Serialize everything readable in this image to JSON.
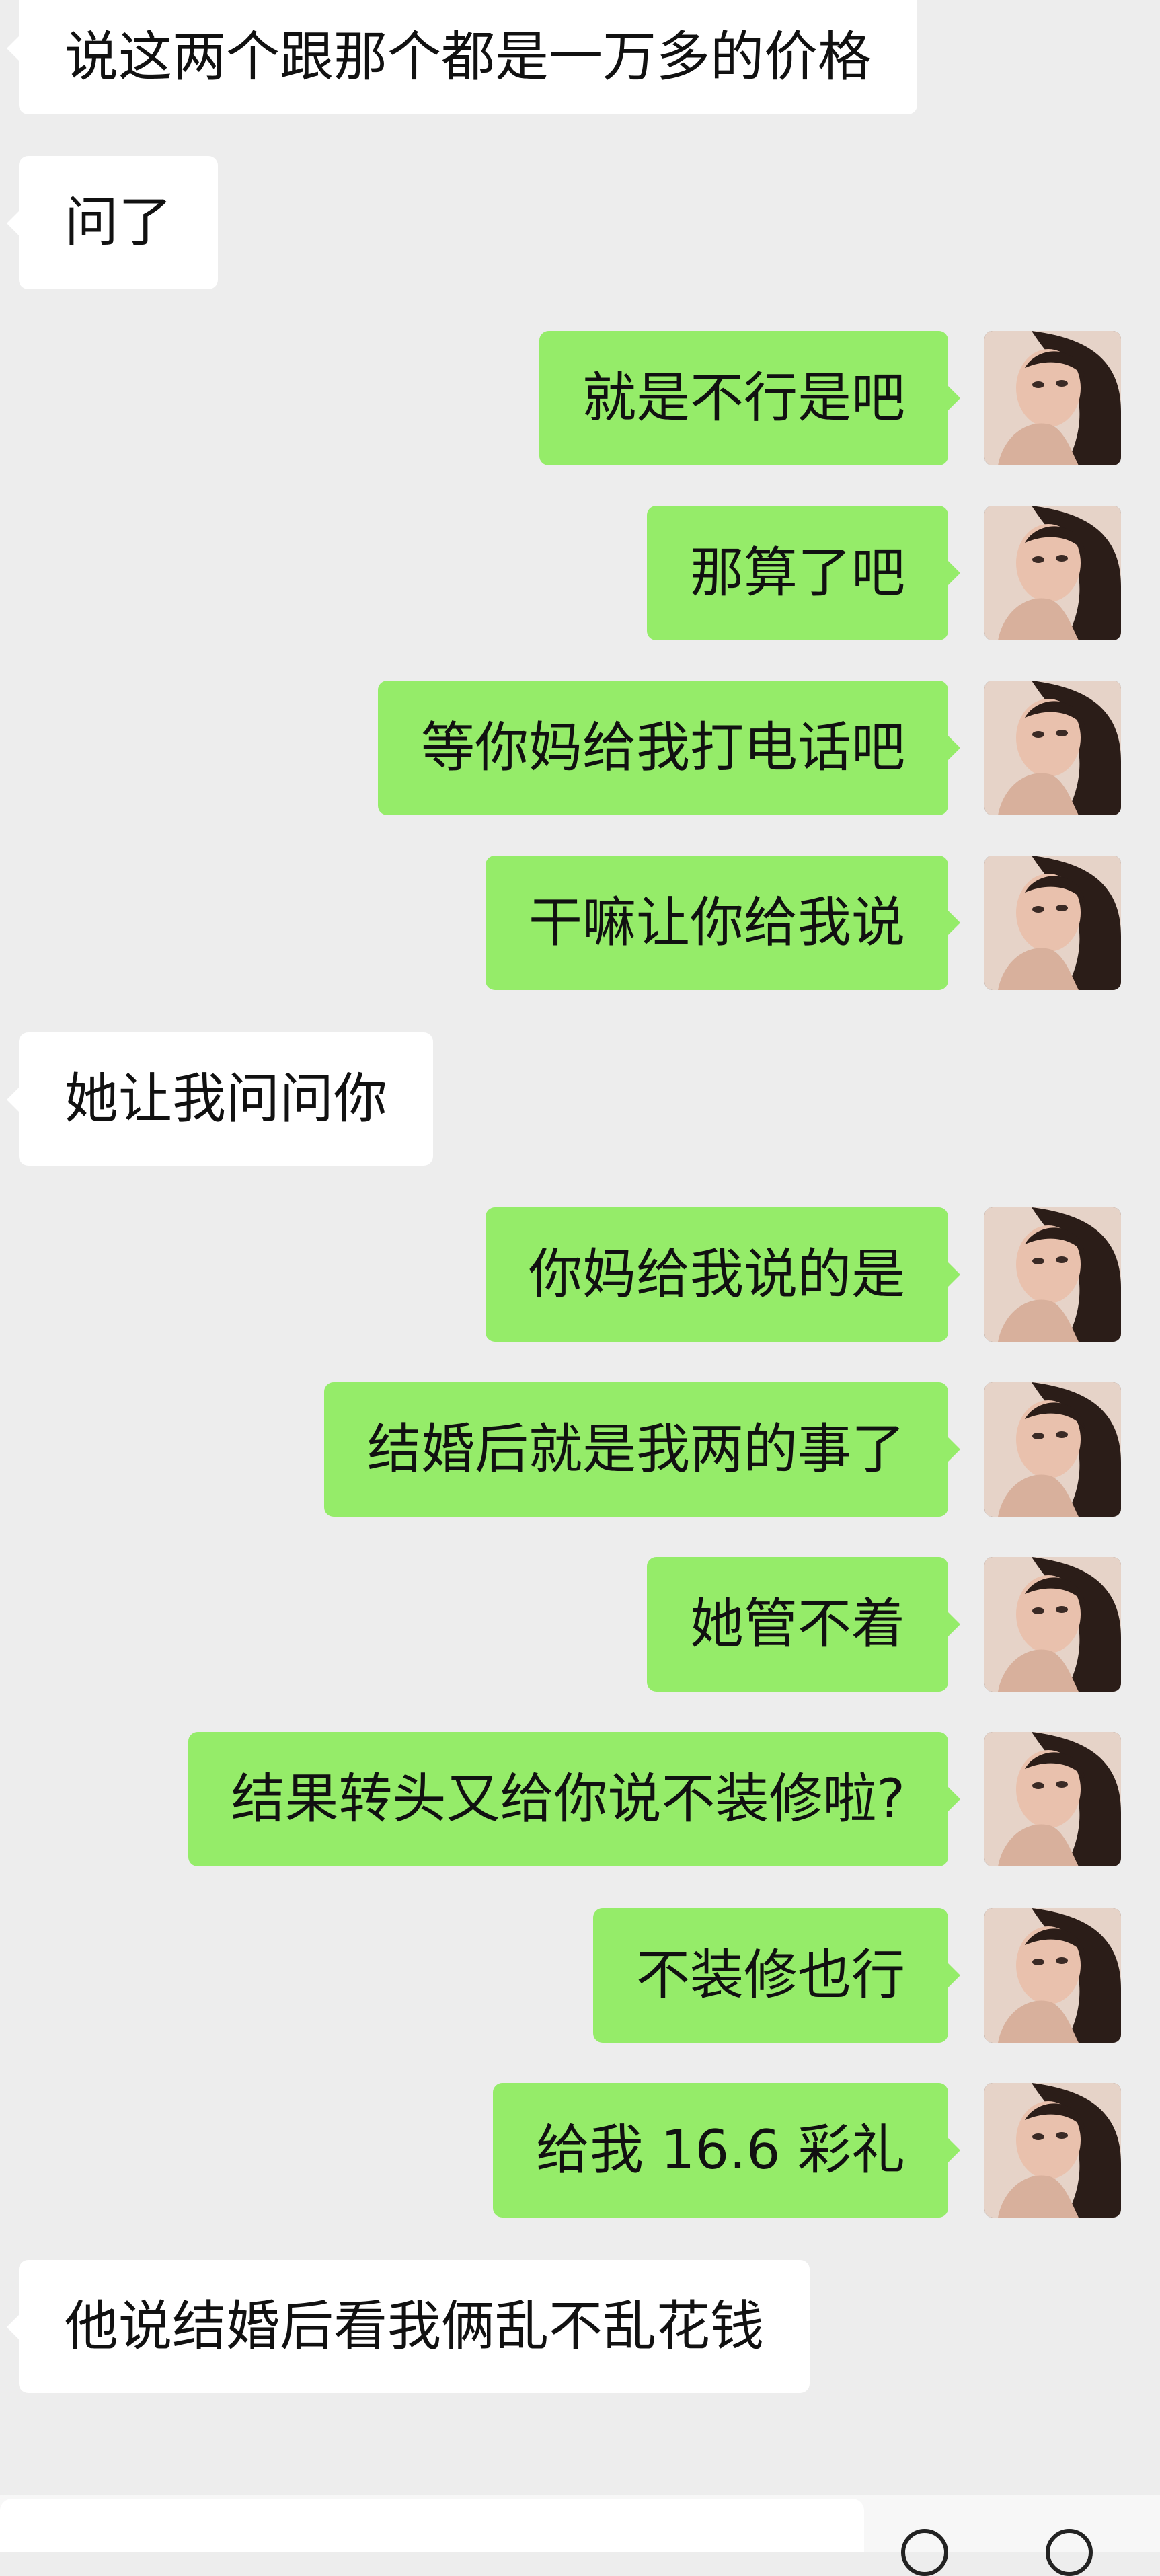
{
  "messages": [
    {
      "side": "in",
      "text": "说这两个跟那个都是一万多的价格"
    },
    {
      "side": "in",
      "text": "问了"
    },
    {
      "side": "out",
      "text": "就是不行是吧"
    },
    {
      "side": "out",
      "text": "那算了吧"
    },
    {
      "side": "out",
      "text": "等你妈给我打电话吧"
    },
    {
      "side": "out",
      "text": "干嘛让你给我说"
    },
    {
      "side": "in",
      "text": "她让我问问你"
    },
    {
      "side": "out",
      "text": "你妈给我说的是"
    },
    {
      "side": "out",
      "text": "结婚后就是我两的事了"
    },
    {
      "side": "out",
      "text": "她管不着"
    },
    {
      "side": "out",
      "text": "结果转头又给你说不装修啦?"
    },
    {
      "side": "out",
      "text": "不装修也行"
    },
    {
      "side": "out",
      "text": "给我 16.6 彩礼"
    },
    {
      "side": "in",
      "text": "他说结婚后看我俩乱不乱花钱"
    }
  ],
  "input_bar": {
    "icons": [
      "emoji-icon",
      "add-icon"
    ]
  }
}
